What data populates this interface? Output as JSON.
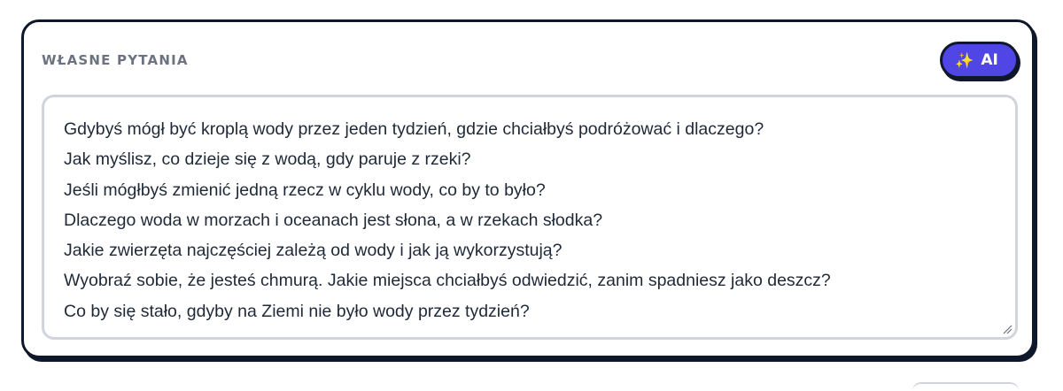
{
  "section": {
    "title": "WŁASNE PYTANIA"
  },
  "ai_button": {
    "icon": "sparkles-icon",
    "label": "AI",
    "color": "#4f46e5"
  },
  "questions": [
    "Gdybyś mógł być kroplą wody przez jeden tydzień, gdzie chciałbyś podróżować i dlaczego?",
    "Jak myślisz, co dzieje się z wodą, gdy paruje z rzeki?",
    "Jeśli mógłbyś zmienić jedną rzecz w cyklu wody, co by to było?",
    "Dlaczego woda w morzach i oceanach jest słona, a w rzekach słodka?",
    "Jakie zwierzęta najczęściej zależą od wody i jak ją wykorzystują?",
    "Wyobraź sobie, że jesteś chmurą. Jakie miejsca chciałbyś odwiedzić, zanim spadniesz jako deszcz?",
    "Co by się stało, gdyby na Ziemi nie było wody przez tydzień?"
  ]
}
